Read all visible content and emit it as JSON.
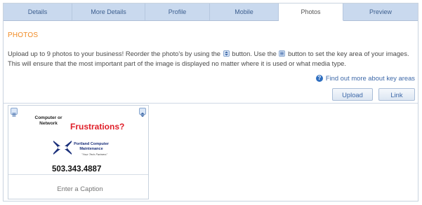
{
  "tabs": [
    {
      "label": "Details",
      "active": false
    },
    {
      "label": "More Details",
      "active": false
    },
    {
      "label": "Profile",
      "active": false
    },
    {
      "label": "Mobile",
      "active": false
    },
    {
      "label": "Photos",
      "active": true
    },
    {
      "label": "Preview",
      "active": false
    }
  ],
  "section": {
    "title": "PHOTOS",
    "desc_part1": "Upload up to 9 photos to your business! Reorder the photo's by using the",
    "desc_part2": "button. Use the",
    "desc_part3": "button to set the key area of your images. This will ensure that the most important part of the image is displayed no matter where it is used or what media type.",
    "help_link": "Find out more about key areas"
  },
  "buttons": {
    "upload": "Upload",
    "link": "Link"
  },
  "photo_card": {
    "caption_placeholder": "Enter a Caption",
    "image": {
      "line_computer": "Computer or",
      "line_network": "Network",
      "headline": "Frustrations?",
      "company_line1": "Portland Computer",
      "company_line2": "Maintenance",
      "tagline": "\"Your Tech Partners\"",
      "phone": "503.343.4887"
    }
  },
  "colors": {
    "accent_orange": "#f08a23",
    "tab_bg": "#c9d9ee",
    "link_blue": "#3d68a8",
    "headline_red": "#e0202a"
  }
}
